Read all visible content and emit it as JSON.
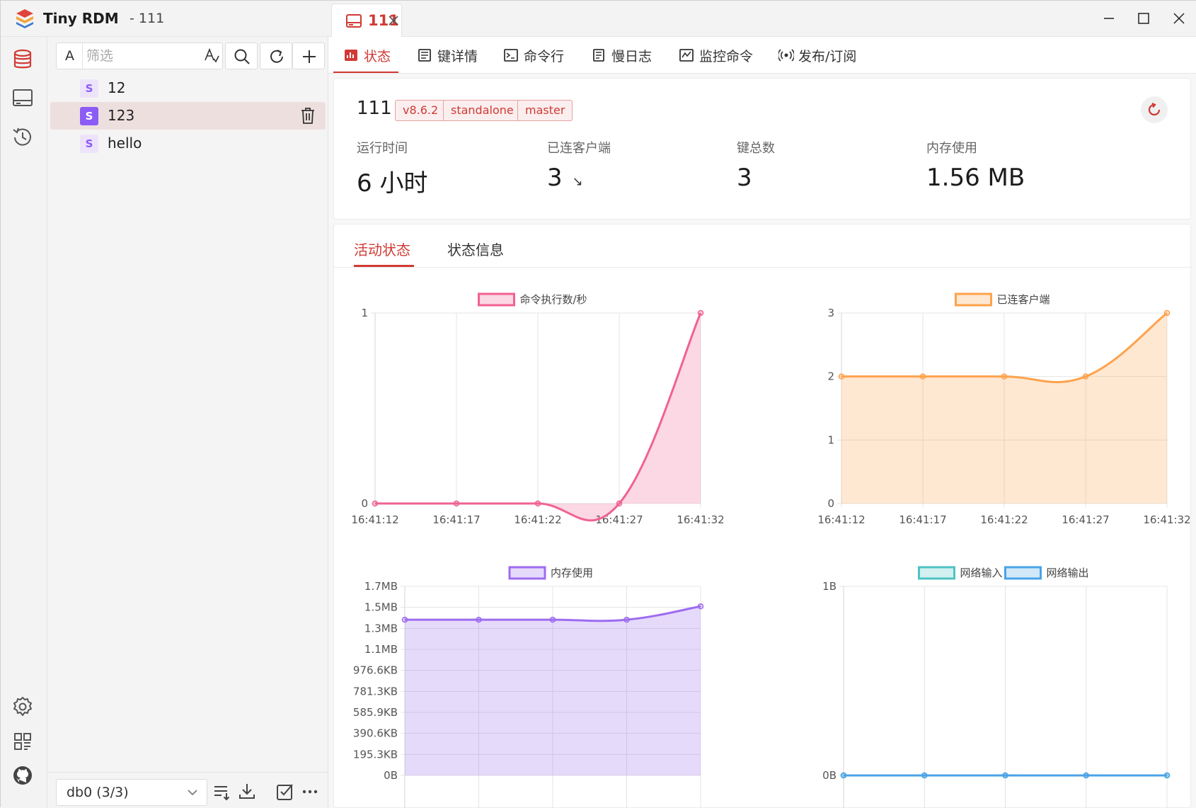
{
  "window": {
    "app_name": "Tiny RDM",
    "app_suffix": "- 111",
    "connection_tab": "111"
  },
  "rail": {
    "items": [
      "database-icon",
      "connection-icon",
      "history-icon"
    ],
    "bottom": [
      "settings-icon",
      "apps-icon",
      "github-icon"
    ]
  },
  "sidebar": {
    "filter_case_label": "A",
    "filter_placeholder": "筛选",
    "keys": [
      {
        "type": "S",
        "name": "12"
      },
      {
        "type": "S",
        "name": "123"
      },
      {
        "type": "S",
        "name": "hello"
      }
    ],
    "db_select": "db0 (3/3)"
  },
  "subtabs": [
    "状态",
    "键详情",
    "命令行",
    "慢日志",
    "监控命令",
    "发布/订阅"
  ],
  "server": {
    "name": "111",
    "tags": [
      "v8.6.2",
      "standalone",
      "master"
    ]
  },
  "stats": [
    {
      "label": "运行时间",
      "value": "6 小时",
      "trend": ""
    },
    {
      "label": "已连客户端",
      "value": "3",
      "trend": "↘"
    },
    {
      "label": "键总数",
      "value": "3",
      "trend": ""
    },
    {
      "label": "内存使用",
      "value": "1.56 MB",
      "trend": ""
    }
  ],
  "panel_tabs": [
    "活动状态",
    "状态信息"
  ],
  "colors": {
    "accent": "#d03a35",
    "cmd": "#f06292",
    "clients": "#ffa24c",
    "memory": "#9d6cf0",
    "net_in": "#4fc3c3",
    "net_out": "#4aa3e8"
  },
  "chart_data": [
    {
      "type": "line",
      "title": "",
      "legend": [
        "命令执行数/秒"
      ],
      "x": [
        "16:41:12",
        "16:41:17",
        "16:41:22",
        "16:41:27",
        "16:41:32"
      ],
      "series": [
        {
          "name": "命令执行数/秒",
          "values": [
            0,
            0,
            0,
            0,
            1
          ]
        }
      ],
      "ylim": [
        0,
        1
      ],
      "yticks": [
        "0",
        "1"
      ],
      "grid": true
    },
    {
      "type": "line",
      "title": "",
      "legend": [
        "已连客户端"
      ],
      "x": [
        "16:41:12",
        "16:41:17",
        "16:41:22",
        "16:41:27",
        "16:41:32"
      ],
      "series": [
        {
          "name": "已连客户端",
          "values": [
            2,
            2,
            2,
            2,
            3
          ]
        }
      ],
      "ylim": [
        0,
        3
      ],
      "yticks": [
        "0",
        "1",
        "2",
        "3"
      ],
      "grid": true
    },
    {
      "type": "line",
      "title": "",
      "legend": [
        "内存使用"
      ],
      "x": [
        "",
        "",
        "",
        "",
        ""
      ],
      "series": [
        {
          "name": "内存使用",
          "values": [
            1.4,
            1.4,
            1.4,
            1.4,
            1.52
          ]
        }
      ],
      "ylim": [
        0,
        1.7
      ],
      "yticks": [
        "0B",
        "195.3KB",
        "390.6KB",
        "585.9KB",
        "781.3KB",
        "976.6KB",
        "1.1MB",
        "1.3MB",
        "1.5MB",
        "1.7MB"
      ],
      "grid": true
    },
    {
      "type": "line",
      "title": "",
      "legend": [
        "网络输入",
        "网络输出"
      ],
      "x": [
        "",
        "",
        "",
        "",
        ""
      ],
      "series": [
        {
          "name": "网络输入",
          "values": [
            0,
            0,
            0,
            0,
            0
          ]
        },
        {
          "name": "网络输出",
          "values": [
            0,
            0,
            0,
            0,
            0
          ]
        }
      ],
      "ylim": [
        0,
        1
      ],
      "yticks": [
        "0B",
        "1B"
      ],
      "grid": true
    }
  ]
}
